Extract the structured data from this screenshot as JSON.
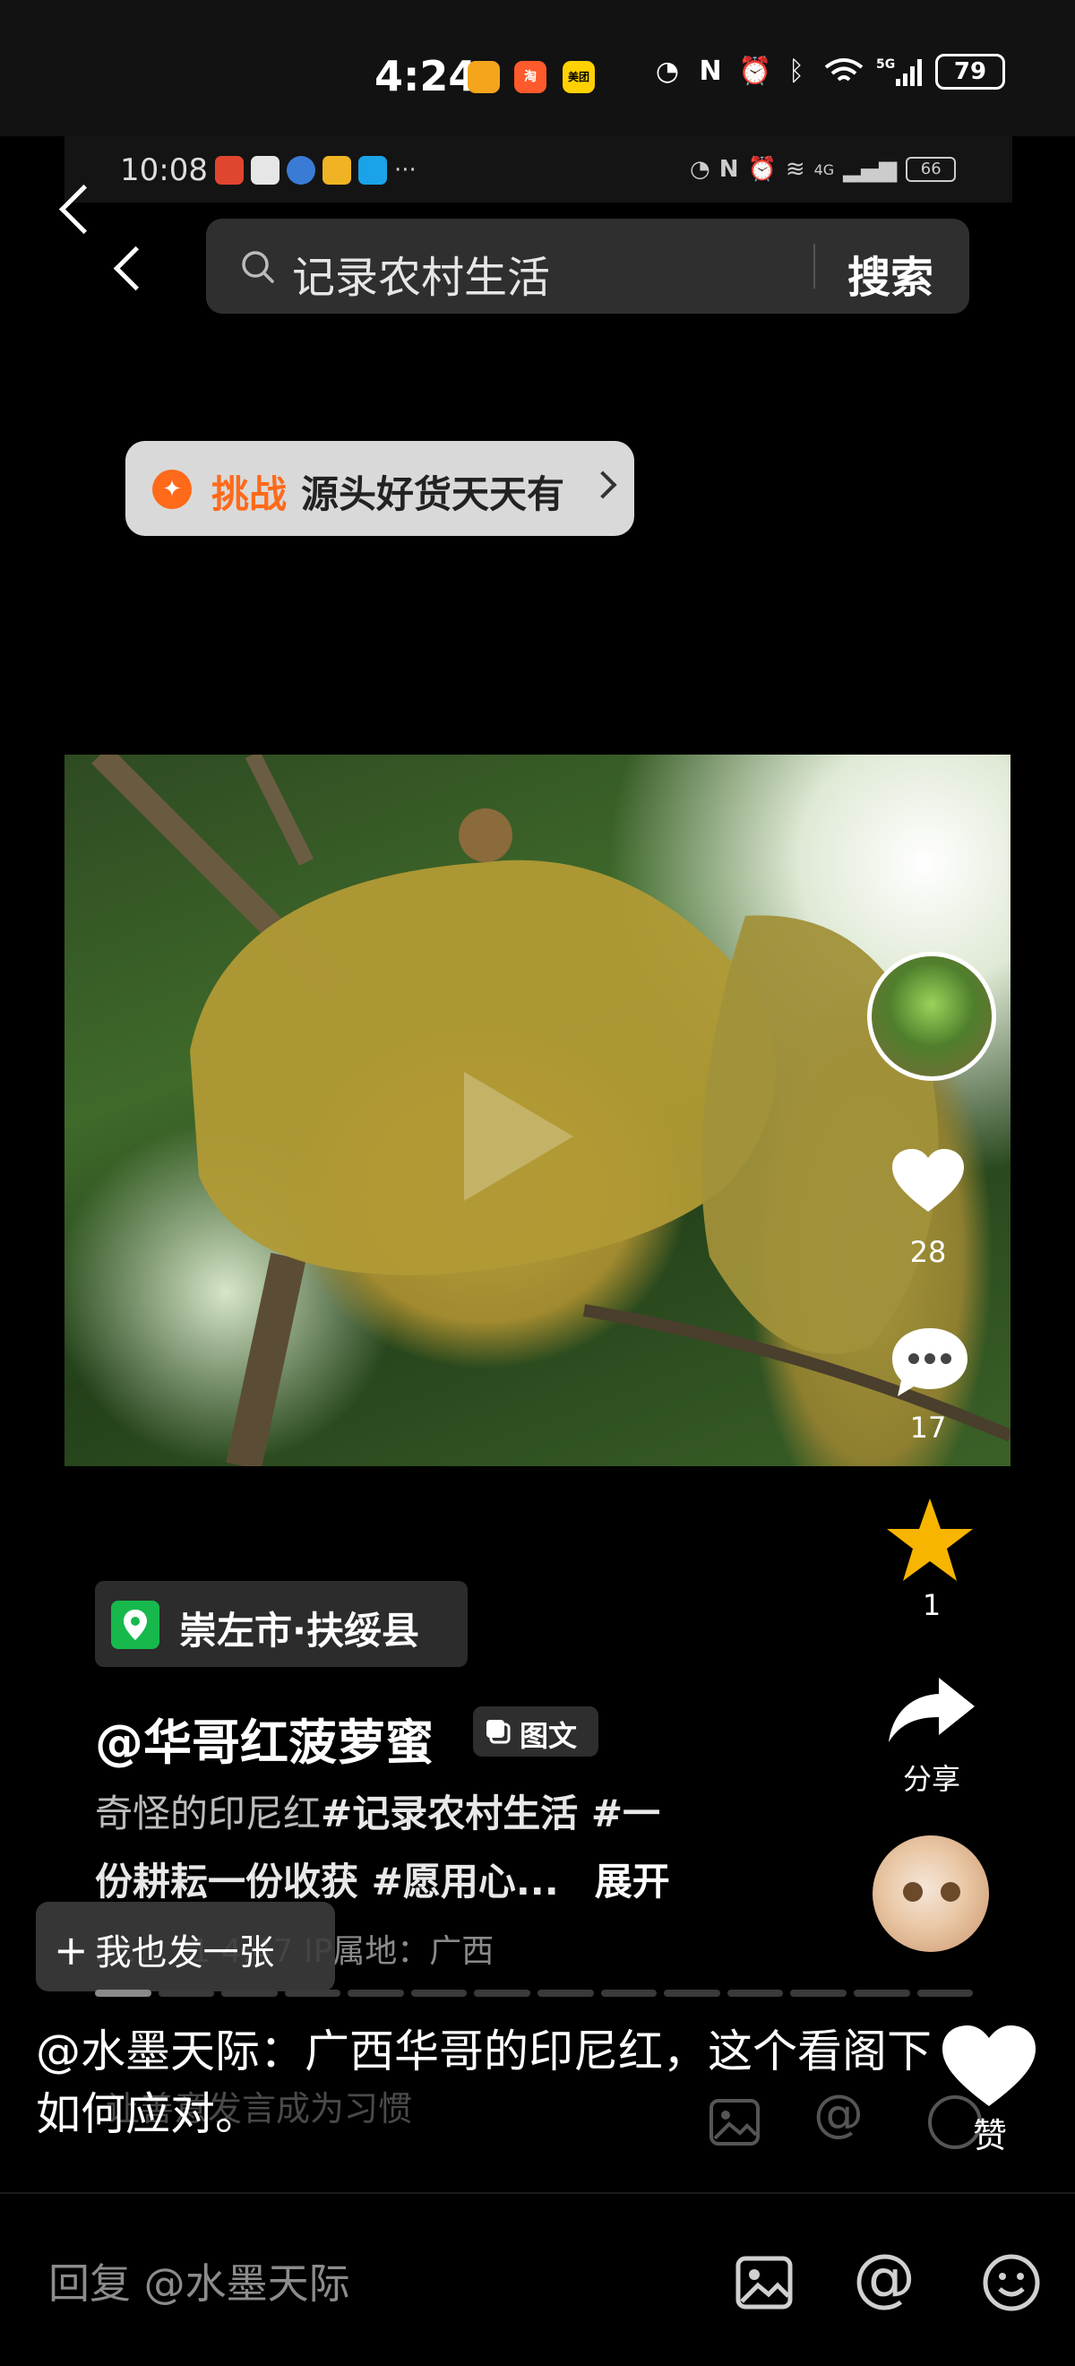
{
  "status_bar": {
    "time": "4:24",
    "app_badges": [
      {
        "name": "app-orange",
        "text": "",
        "color": "#f5a51b"
      },
      {
        "name": "taobao",
        "text": "淘",
        "color": "#ff5a2c"
      },
      {
        "name": "meituan",
        "text": "美团",
        "color": "#ffd100"
      }
    ],
    "icons": [
      "speed-icon",
      "nfc-icon",
      "alarm-icon",
      "bluetooth-icon",
      "wifi-icon",
      "signal-5g-icon"
    ],
    "battery": "79"
  },
  "inner_status": {
    "time": "10:08",
    "battery": "66",
    "network": "4G",
    "more": "···"
  },
  "search": {
    "query": "记录农村生活",
    "button": "搜索"
  },
  "challenge": {
    "tag": "挑战",
    "text": "源头好货天天有"
  },
  "actions": {
    "likes": "28",
    "comments": "17",
    "favorites": "1",
    "share": "分享"
  },
  "post": {
    "location": "崇左市·扶绥县",
    "author": "@华哥红菠萝蜜",
    "type_tag": "图文",
    "desc_line1_plain": "奇怪的印尼红",
    "desc_line1_tags": "#记录农村生活 #一",
    "desc_line2_tags": "份耕耘一份收获 #愿用心...",
    "expand": "展开",
    "meta": "2… …1 4:47  IP属地：广西",
    "post_button": "我也发一张",
    "progress_total": 14,
    "progress_active": 1
  },
  "comment": {
    "text": "@水墨天际：广西华哥的印尼红，这个看阁下如何应对。",
    "faint_text": "让善意发言成为习惯",
    "like_label": "赞"
  },
  "reply": {
    "placeholder": "回复 @水墨天际"
  },
  "colors": {
    "accent_orange": "#ff6a1a",
    "star": "#f7b500",
    "location_green": "#17b94d"
  }
}
